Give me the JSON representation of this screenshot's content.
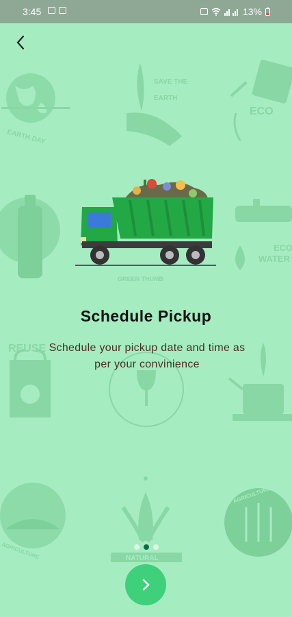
{
  "status_bar": {
    "time": "3:45",
    "battery": "13%"
  },
  "icons": {
    "back": "back-arrow-icon",
    "next": "chevron-right-icon"
  },
  "background_labels": {
    "earth_day": "EARTH DAY",
    "save_the": "SAVE THE",
    "earth": "EARTH",
    "eco": "ECO",
    "eco_water_1": "ECO",
    "eco_water_2": "WATER",
    "green_thumb": "GREEN THUMB",
    "reuse": "REUSE",
    "agriculture_1": "AGRICULTURE",
    "agriculture_2": "AGRICULTURE",
    "natural": "NATURAL"
  },
  "onboarding": {
    "title": "Schedule Pickup",
    "subtitle": "Schedule your pickup date and time as per your convinience",
    "page_count": 3,
    "active_page": 2
  },
  "colors": {
    "background": "#a6ecc1",
    "accent": "#3fd07c",
    "truck_green": "#22a844",
    "active_dot": "#0f6a4b"
  }
}
